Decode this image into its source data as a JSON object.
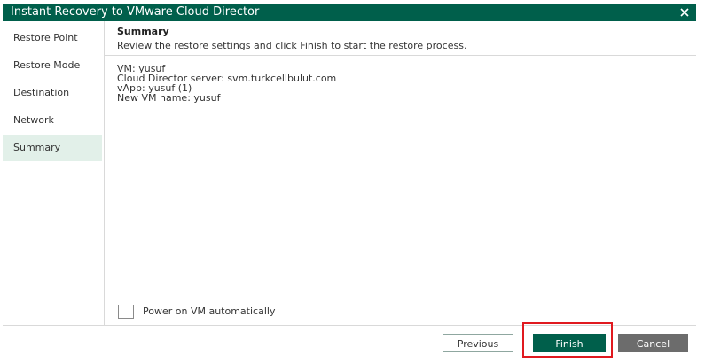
{
  "window": {
    "title": "Instant Recovery to VMware Cloud Director",
    "close_icon": "close-icon"
  },
  "sidebar": {
    "items": [
      {
        "label": "Restore Point",
        "active": false
      },
      {
        "label": "Restore Mode",
        "active": false
      },
      {
        "label": "Destination",
        "active": false
      },
      {
        "label": "Network",
        "active": false
      },
      {
        "label": "Summary",
        "active": true
      }
    ]
  },
  "header": {
    "title": "Summary",
    "description": "Review the restore settings and click Finish to start the restore process."
  },
  "summary": {
    "lines": [
      "VM: yusuf",
      "Cloud Director server: svm.turkcellbulut.com",
      "vApp: yusuf (1)",
      "New VM name: yusuf"
    ]
  },
  "options": {
    "power_on_label": "Power on VM automatically",
    "power_on_checked": false
  },
  "buttons": {
    "previous": "Previous",
    "finish": "Finish",
    "cancel": "Cancel"
  },
  "colors": {
    "brand": "#005f4b",
    "active_nav": "#e2f0e9",
    "highlight": "#e0191f",
    "cancel": "#6c6c6c"
  }
}
